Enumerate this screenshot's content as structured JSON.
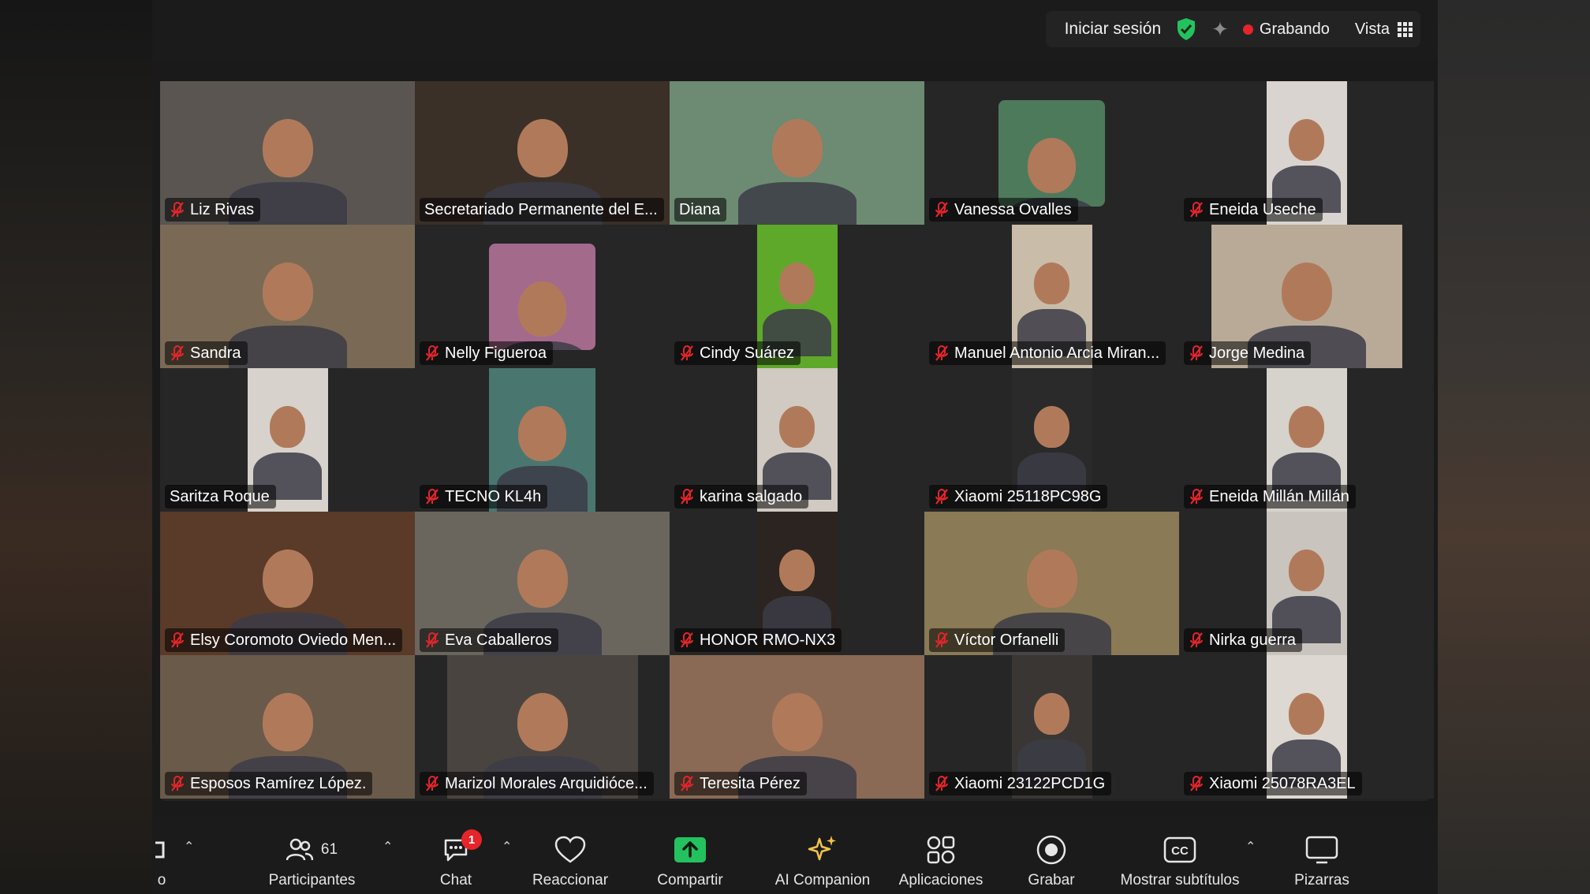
{
  "topbar": {
    "signin_label": "Iniciar sesión",
    "recording_label": "Grabando",
    "view_label": "Vista"
  },
  "participants": [
    {
      "name": "Liz Rivas",
      "muted": true,
      "bg": "#5a5550"
    },
    {
      "name": "Secretariado Permanente del E...",
      "muted": false,
      "active": true,
      "bg": "#3a3028"
    },
    {
      "name": "Diana",
      "muted": false,
      "bg": "#6d8a73"
    },
    {
      "name": "Vanessa Ovalles",
      "muted": true,
      "bg": "#262626",
      "inset": "#4e7a5c"
    },
    {
      "name": "Eneida Useche",
      "muted": true,
      "bg": "#262626",
      "inset": "#d9d4cf"
    },
    {
      "name": "Sandra",
      "muted": true,
      "bg": "#7a6a55"
    },
    {
      "name": "Nelly Figueroa",
      "muted": true,
      "bg": "#262626",
      "inset": "#a46a8c"
    },
    {
      "name": "Cindy Suárez",
      "muted": true,
      "bg": "#262626",
      "inset": "#5fa92a"
    },
    {
      "name": "Manuel Antonio Arcia Miran...",
      "muted": true,
      "bg": "#262626",
      "inset": "#c9bda9"
    },
    {
      "name": "Jorge Medina",
      "muted": true,
      "bg": "#262626",
      "inset": "#b9aa98"
    },
    {
      "name": "Saritza Roque",
      "muted": false,
      "bg": "#262626",
      "inset": "#d8d2cc"
    },
    {
      "name": "TECNO KL4h",
      "muted": true,
      "bg": "#262626",
      "inset": "#4a7670"
    },
    {
      "name": "karina salgado",
      "muted": true,
      "bg": "#262626",
      "inset": "#d0cac2"
    },
    {
      "name": "Xiaomi 25118PC98G",
      "muted": true,
      "bg": "#262626",
      "inset": "#2a2a2a"
    },
    {
      "name": "Eneida Millán Millán",
      "muted": true,
      "bg": "#262626",
      "inset": "#d6d2cc"
    },
    {
      "name": "Elsy Coromoto Oviedo Men...",
      "muted": true,
      "bg": "#5a3a28"
    },
    {
      "name": "Eva Caballeros",
      "muted": true,
      "bg": "#6a665e"
    },
    {
      "name": "HONOR RMO-NX3",
      "muted": true,
      "bg": "#262626",
      "inset": "#2c2420"
    },
    {
      "name": "Víctor Orfanelli",
      "muted": true,
      "bg": "#8a7a55"
    },
    {
      "name": "Nirka guerra",
      "muted": true,
      "bg": "#262626",
      "inset": "#c9c4be"
    },
    {
      "name": "Esposos Ramírez López.",
      "muted": true,
      "bg": "#6a5a4a"
    },
    {
      "name": "Marizol Morales Arquidióce...",
      "muted": true,
      "bg": "#262626",
      "inset": "#4a4440"
    },
    {
      "name": "Teresita Pérez",
      "muted": true,
      "bg": "#8a6a55"
    },
    {
      "name": "Xiaomi 23122PCD1G",
      "muted": true,
      "bg": "#262626",
      "inset": "#3a3634"
    },
    {
      "name": "Xiaomi 25078RA3EL",
      "muted": true,
      "bg": "#262626",
      "inset": "#ddd8d2"
    }
  ],
  "toolbar": {
    "clipped_label": "o",
    "participants_label": "Participantes",
    "participants_count": "61",
    "chat_label": "Chat",
    "chat_badge": "1",
    "react_label": "Reaccionar",
    "share_label": "Compartir",
    "ai_label": "AI Companion",
    "apps_label": "Aplicaciones",
    "record_label": "Grabar",
    "captions_label": "Mostrar subtítulos",
    "whiteboards_label": "Pizarras"
  },
  "colors": {
    "recording": "#e5252a",
    "active_speaker": "#23d96b",
    "share": "#23c25e",
    "shield": "#23c25e",
    "mic_muted": "#e5252a"
  }
}
